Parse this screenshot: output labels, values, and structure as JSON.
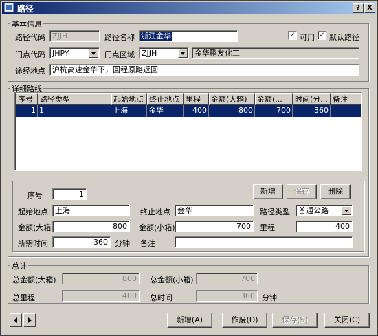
{
  "window": {
    "title": "路径",
    "help_label": "?",
    "close_label": "X"
  },
  "basic": {
    "legend": "基本信息",
    "route_code_label": "路径代码",
    "route_code_value": "ZJJH",
    "route_name_label": "路径名称",
    "route_name_value": "浙江金华",
    "available_label": "可用",
    "available_checked": true,
    "default_label": "默认路径",
    "default_checked": true,
    "store_code_label": "门点代码",
    "store_code_value": "JHPY",
    "store_area_label": "门点区域",
    "store_area_value": "ZJJH",
    "store_area_name": "金华鹏友化工",
    "via_label": "途经地点",
    "via_value": "沪杭高速金华下，回程原路返回"
  },
  "detail": {
    "legend": "详细路线",
    "columns": [
      "序号",
      "路径类型",
      "起始地点",
      "终止地点",
      "里程",
      "金额(大箱)",
      "金额(...",
      "时间(分...",
      "备注"
    ],
    "rows": [
      [
        "1",
        "1",
        "上海",
        "金华",
        "400",
        "800",
        "700",
        "360",
        ""
      ]
    ]
  },
  "form": {
    "seq_label": "序号",
    "seq_value": "1",
    "new_button": "新增",
    "save_button": "保存",
    "delete_button": "删除",
    "start_label": "起始地点",
    "start_value": "上海",
    "end_label": "终止地点",
    "end_value": "金华",
    "route_type_label": "路径类型",
    "route_type_value": "普通公路",
    "amount_large_label": "金额(大箱",
    "amount_large_value": "800",
    "amount_small_label": "金额(小箱)",
    "amount_small_value": "700",
    "mileage_label": "里程",
    "mileage_value": "400",
    "time_label": "所需时间",
    "time_value": "360",
    "time_unit": "分钟",
    "remark_label": "备注",
    "remark_value": ""
  },
  "totals": {
    "legend": "总计",
    "total_large_label": "总金额(大箱)",
    "total_large_value": "800",
    "total_small_label": "总金额(小箱)",
    "total_small_value": "700",
    "total_mileage_label": "总里程",
    "total_mileage_value": "400",
    "total_time_label": "总时间",
    "total_time_value": "360",
    "total_time_unit": "分钟"
  },
  "footer": {
    "new_button": "新增(A)",
    "void_button": "作废(D)",
    "save_button": "保存(S)",
    "close_button": "关闭(C)"
  }
}
